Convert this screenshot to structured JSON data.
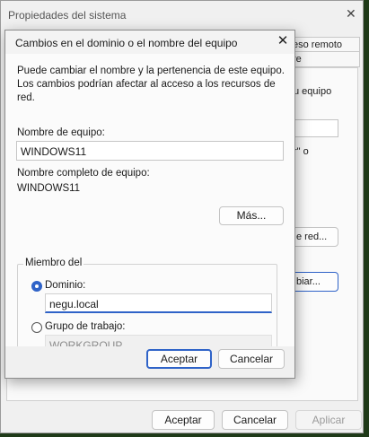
{
  "background_window": {
    "title": "Propiedades del sistema",
    "close_glyph": "✕",
    "tabs": [
      "eso remoto",
      "re"
    ],
    "partial_text_1": "u equipo",
    "partial_text_2": "r\" o",
    "button_red": "e red...",
    "button_cambiar": "biar...",
    "ok_label": "Aceptar",
    "cancel_label": "Cancelar",
    "apply_label": "Aplicar"
  },
  "dialog": {
    "title": "Cambios en el dominio o el nombre del equipo",
    "close_glyph": "✕",
    "intro": "Puede cambiar el nombre y la pertenencia de este equipo. Los cambios podrían afectar al acceso a los recursos de red.",
    "computer_name_label": "Nombre de equipo:",
    "computer_name_value": "WINDOWS11",
    "full_name_label": "Nombre completo de equipo:",
    "full_name_value": "WINDOWS11",
    "more_button": "Más...",
    "member_of_label": "Miembro del",
    "domain_option": "Dominio:",
    "domain_value": "negu.local",
    "workgroup_option": "Grupo de trabajo:",
    "workgroup_value": "WORKGROUP",
    "ok_label": "Aceptar",
    "cancel_label": "Cancelar",
    "selected_membership": "domain"
  },
  "colors": {
    "accent": "#2f63c8"
  }
}
